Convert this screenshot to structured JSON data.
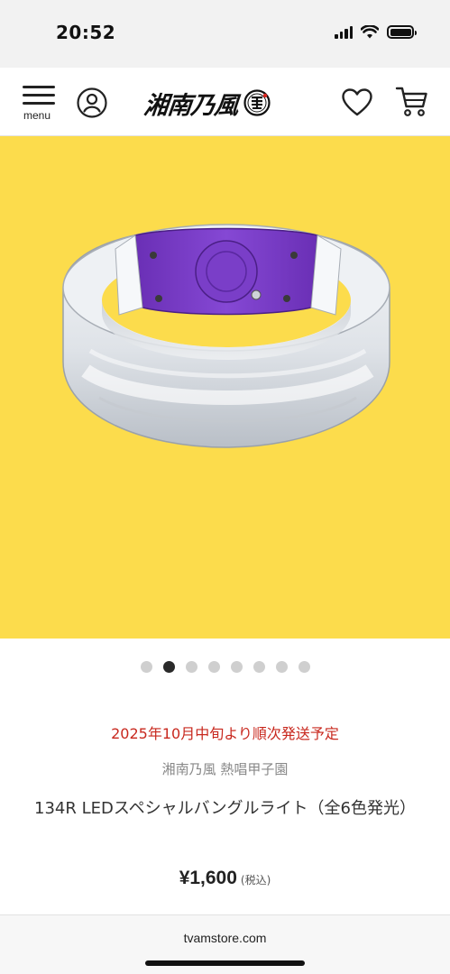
{
  "status_bar": {
    "time": "20:52"
  },
  "header": {
    "menu_label": "menu",
    "logo_text": "湘南乃風",
    "icons": [
      "menu-icon",
      "account-icon",
      "heart-icon",
      "cart-icon"
    ]
  },
  "gallery": {
    "total_slides": 8,
    "active_index": 1,
    "background_color": "#fcdc4c",
    "band_color": "#7b3fc4"
  },
  "product": {
    "shipping_note": "2025年10月中旬より順次発送予定",
    "category": "湘南乃風 熱唱甲子園",
    "title": "134R LEDスペシャルバングルライト（全6色発光）",
    "price": "¥1,600",
    "tax_label": "(税込)"
  },
  "browser": {
    "url": "tvamstore.com"
  },
  "colors": {
    "accent_red": "#c8281e",
    "dot_active": "#2a2a2a",
    "dot_inactive": "#cfcfcf"
  }
}
